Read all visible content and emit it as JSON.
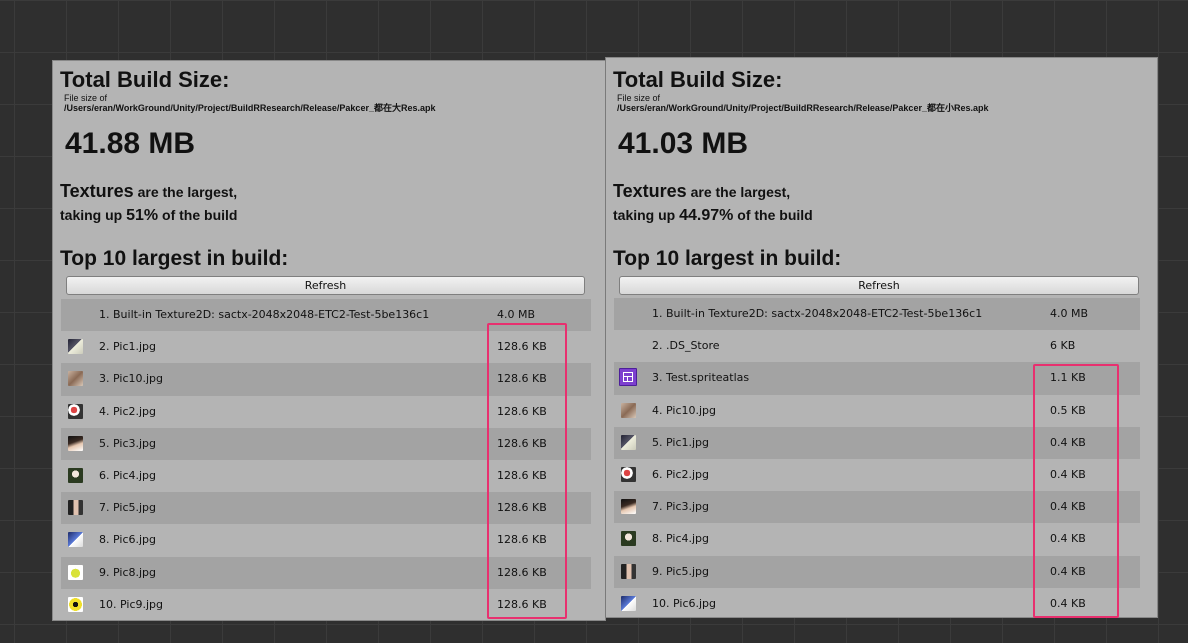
{
  "panels": [
    {
      "total_title": "Total Build Size:",
      "file_size_label": "File size of",
      "file_path": "/Users/eran/WorkGround/Unity/Project/BuildRResearch/Release/Pakcer_都在大Res.apk",
      "size_value": "41.88 MB",
      "summary": {
        "category": "Textures",
        "line1_rest": " are the largest,",
        "line2_prefix": "taking up ",
        "percent": "51%",
        "line2_suffix": " of the build"
      },
      "top_title": "Top 10 largest in build:",
      "refresh_label": "Refresh",
      "items": [
        {
          "label": "1. Built-in Texture2D: sactx-2048x2048-ETC2-Test-5be136c1",
          "size": "4.0 MB",
          "icon": "none"
        },
        {
          "label": "2. Pic1.jpg",
          "size": "128.6 KB",
          "icon": "image-thumbnail-icon"
        },
        {
          "label": "3. Pic10.jpg",
          "size": "128.6 KB",
          "icon": "image-thumbnail-icon"
        },
        {
          "label": "4. Pic2.jpg",
          "size": "128.6 KB",
          "icon": "image-thumbnail-icon"
        },
        {
          "label": "5. Pic3.jpg",
          "size": "128.6 KB",
          "icon": "image-thumbnail-icon"
        },
        {
          "label": "6. Pic4.jpg",
          "size": "128.6 KB",
          "icon": "image-thumbnail-icon"
        },
        {
          "label": "7. Pic5.jpg",
          "size": "128.6 KB",
          "icon": "image-thumbnail-icon"
        },
        {
          "label": "8. Pic6.jpg",
          "size": "128.6 KB",
          "icon": "image-thumbnail-icon"
        },
        {
          "label": "9. Pic8.jpg",
          "size": "128.6 KB",
          "icon": "image-thumbnail-icon"
        },
        {
          "label": "10. Pic9.jpg",
          "size": "128.6 KB",
          "icon": "image-thumbnail-icon"
        }
      ]
    },
    {
      "total_title": "Total Build Size:",
      "file_size_label": "File size of",
      "file_path": "/Users/eran/WorkGround/Unity/Project/BuildRResearch/Release/Pakcer_都在小Res.apk",
      "size_value": "41.03 MB",
      "summary": {
        "category": "Textures",
        "line1_rest": " are the largest,",
        "line2_prefix": "taking up ",
        "percent": "44.97%",
        "line2_suffix": " of the build"
      },
      "top_title": "Top 10 largest in build:",
      "refresh_label": "Refresh",
      "items": [
        {
          "label": "1. Built-in Texture2D: sactx-2048x2048-ETC2-Test-5be136c1",
          "size": "4.0 MB",
          "icon": "none"
        },
        {
          "label": "2. .DS_Store",
          "size": "6 KB",
          "icon": "none"
        },
        {
          "label": "3. Test.spriteatlas",
          "size": "1.1 KB",
          "icon": "sprite-atlas-icon"
        },
        {
          "label": "4. Pic10.jpg",
          "size": "0.5 KB",
          "icon": "image-thumbnail-icon"
        },
        {
          "label": "5. Pic1.jpg",
          "size": "0.4 KB",
          "icon": "image-thumbnail-icon"
        },
        {
          "label": "6. Pic2.jpg",
          "size": "0.4 KB",
          "icon": "image-thumbnail-icon"
        },
        {
          "label": "7. Pic3.jpg",
          "size": "0.4 KB",
          "icon": "image-thumbnail-icon"
        },
        {
          "label": "8. Pic4.jpg",
          "size": "0.4 KB",
          "icon": "image-thumbnail-icon"
        },
        {
          "label": "9. Pic5.jpg",
          "size": "0.4 KB",
          "icon": "image-thumbnail-icon"
        },
        {
          "label": "10. Pic6.jpg",
          "size": "0.4 KB",
          "icon": "image-thumbnail-icon"
        }
      ]
    }
  ],
  "colors": {
    "editor_background": "#2f2f2f",
    "panel_background": "#b4b4b4",
    "row_alternate": "#a3a3a3",
    "highlight_annotation": "#e8306f",
    "sprite_atlas": "#7d3fcf"
  }
}
